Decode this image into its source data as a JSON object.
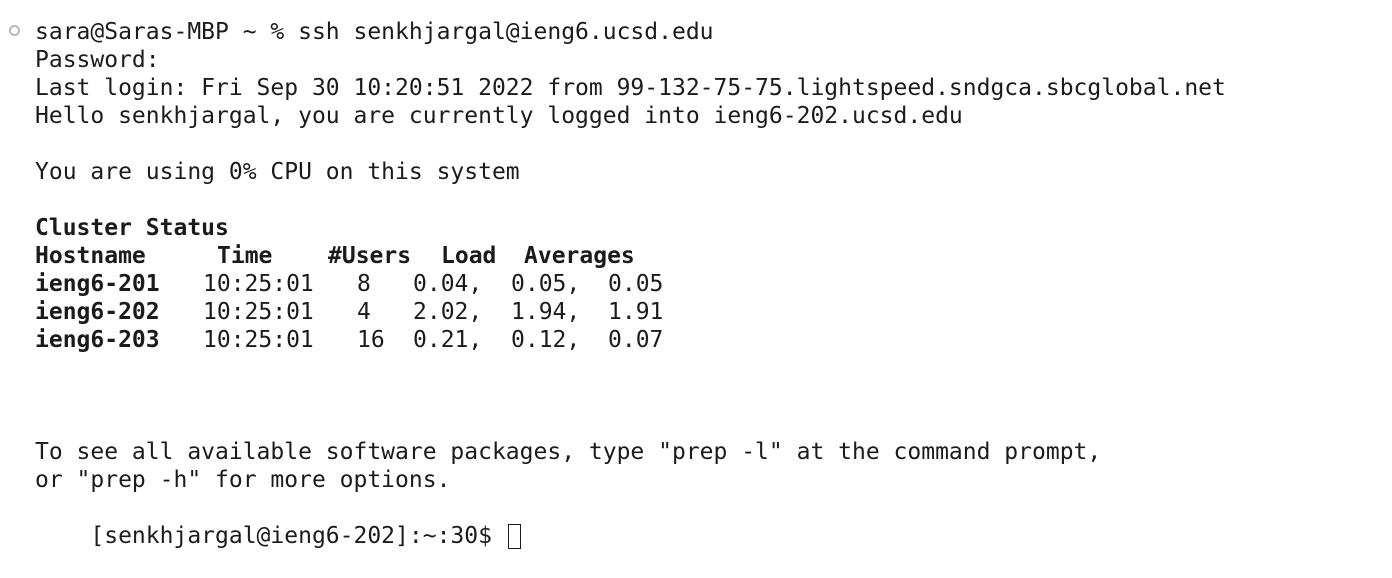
{
  "session": {
    "command_line": "sara@Saras-MBP ~ % ssh senkhjargal@ieng6.ucsd.edu",
    "password_prompt": "Password:",
    "last_login": "Last login: Fri Sep 30 10:20:51 2022 from 99-132-75-75.lightspeed.sndgca.sbcglobal.net",
    "hello": "Hello senkhjargal, you are currently logged into ieng6-202.ucsd.edu",
    "cpu_usage": "You are using 0% CPU on this system"
  },
  "cluster": {
    "title": "Cluster Status",
    "headers": {
      "hostname": "Hostname",
      "time": "Time",
      "users": "#Users",
      "load": "Load",
      "averages": "Averages"
    },
    "rows": [
      {
        "host": "ieng6-201",
        "time": "10:25:01",
        "users": "8",
        "load1": "0.04,",
        "load5": "0.05,",
        "load15": "0.05"
      },
      {
        "host": "ieng6-202",
        "time": "10:25:01",
        "users": "4",
        "load1": "2.02,",
        "load5": "1.94,",
        "load15": "1.91"
      },
      {
        "host": "ieng6-203",
        "time": "10:25:01",
        "users": "16",
        "load1": "0.21,",
        "load5": "0.12,",
        "load15": "0.07"
      }
    ]
  },
  "footer": {
    "prep_info_1": "To see all available software packages, type \"prep -l\" at the command prompt,",
    "prep_info_2": "or \"prep -h\" for more options.",
    "prompt": "[senkhjargal@ieng6-202]:~:30$ "
  },
  "icons": {
    "command_marker": "circle-marker-icon",
    "cursor": "block-cursor-icon"
  }
}
